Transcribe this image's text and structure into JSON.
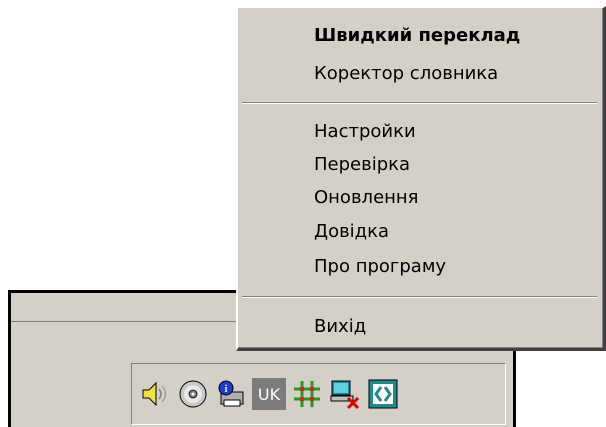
{
  "menu": {
    "items": [
      {
        "label": "Швидкий переклад",
        "bold": true
      },
      {
        "label": "Коректор словника"
      },
      {
        "label": "Настройки"
      },
      {
        "label": "Перевірка"
      },
      {
        "label": "Оновлення"
      },
      {
        "label": "Довідка"
      },
      {
        "label": "Про програму"
      },
      {
        "label": "Вихід"
      }
    ]
  },
  "tray": {
    "icons": [
      {
        "name": "speaker-icon"
      },
      {
        "name": "cd-icon"
      },
      {
        "name": "info-printer-icon"
      },
      {
        "name": "language-indicator",
        "label": "UK"
      },
      {
        "name": "network-grid-icon"
      },
      {
        "name": "network-disconnected-icon"
      },
      {
        "name": "translator-app-icon"
      }
    ]
  },
  "colors": {
    "face": "#d4d0c8",
    "shadow": "#808080",
    "highlight": "#ffffff",
    "lang_badge": "#7c7c7c",
    "app_icon": "#1e8c8c"
  }
}
